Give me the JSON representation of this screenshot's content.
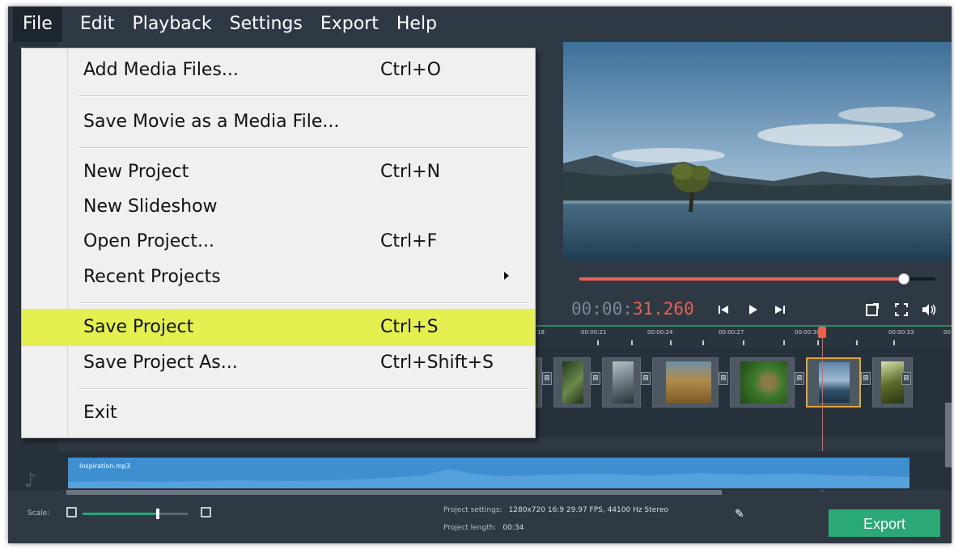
{
  "menubar": {
    "items": [
      "File",
      "Edit",
      "Playback",
      "Settings",
      "Export",
      "Help"
    ]
  },
  "file_menu": {
    "add_media": {
      "label": "Add Media Files...",
      "shortcut": "Ctrl+O"
    },
    "save_movie": {
      "label": "Save Movie as a Media File..."
    },
    "new_project": {
      "label": "New Project",
      "shortcut": "Ctrl+N"
    },
    "new_slideshow": {
      "label": "New Slideshow"
    },
    "open_project": {
      "label": "Open Project...",
      "shortcut": "Ctrl+F"
    },
    "recent_projects": {
      "label": "Recent Projects"
    },
    "save_project": {
      "label": "Save Project",
      "shortcut": "Ctrl+S"
    },
    "save_project_as": {
      "label": "Save Project As...",
      "shortcut": "Ctrl+Shift+S"
    },
    "exit": {
      "label": "Exit"
    },
    "highlight_color": "#e3f04f"
  },
  "player": {
    "timecode_prefix": "00:00:",
    "timecode_highlight": "31.260",
    "progress": 0.91,
    "accent_color": "#e8624f",
    "icons": [
      "skip-back-icon",
      "play-icon",
      "skip-forward-icon",
      "popout-icon",
      "fullscreen-icon",
      "volume-icon"
    ]
  },
  "timeline": {
    "ruler_labels": [
      "18",
      "00:00:21",
      "00:00:24",
      "00:00:27",
      "00:00:30",
      "00:00:33",
      "00"
    ],
    "audio_clip": "Inspiration.mp3",
    "track_color": "#3d8fd0"
  },
  "status": {
    "scale_label": "Scale:",
    "scale_level": 0.7,
    "project_settings_label": "Project settings:",
    "project_settings_value": "1280x720 16:9 29.97 FPS, 44100 Hz Stereo",
    "project_length_label": "Project length:",
    "project_length_value": "00:34",
    "export_label": "Export",
    "export_color": "#2aa875"
  }
}
